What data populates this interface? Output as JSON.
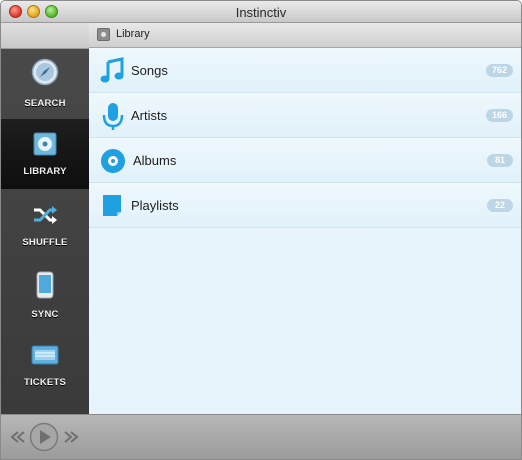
{
  "window": {
    "title": "Instinctiv"
  },
  "sidebar": {
    "items": [
      {
        "id": "search",
        "label": "SEARCH",
        "icon": "compass-icon",
        "active": false
      },
      {
        "id": "library",
        "label": "LIBRARY",
        "icon": "disc-icon",
        "active": true
      },
      {
        "id": "shuffle",
        "label": "SHUFFLE",
        "icon": "shuffle-icon",
        "active": false
      },
      {
        "id": "sync",
        "label": "SYNC",
        "icon": "device-icon",
        "active": false
      },
      {
        "id": "tickets",
        "label": "TICKETS",
        "icon": "ticket-icon",
        "active": false
      }
    ]
  },
  "breadcrumb": {
    "label": "Library",
    "icon": "library-icon"
  },
  "library": {
    "rows": [
      {
        "label": "Songs",
        "count": "762",
        "icon": "music-note-icon"
      },
      {
        "label": "Artists",
        "count": "166",
        "icon": "microphone-icon"
      },
      {
        "label": "Albums",
        "count": "81",
        "icon": "album-disc-icon"
      },
      {
        "label": "Playlists",
        "count": "22",
        "icon": "playlist-icon"
      }
    ]
  },
  "player": {
    "controls": [
      "previous-icon",
      "play-icon",
      "next-icon"
    ]
  },
  "colors": {
    "accent": "#1fa0e0",
    "sidebar": "#3d3d3d",
    "content_bg": "#e8f4fb",
    "badge": "#bdd6e6"
  }
}
